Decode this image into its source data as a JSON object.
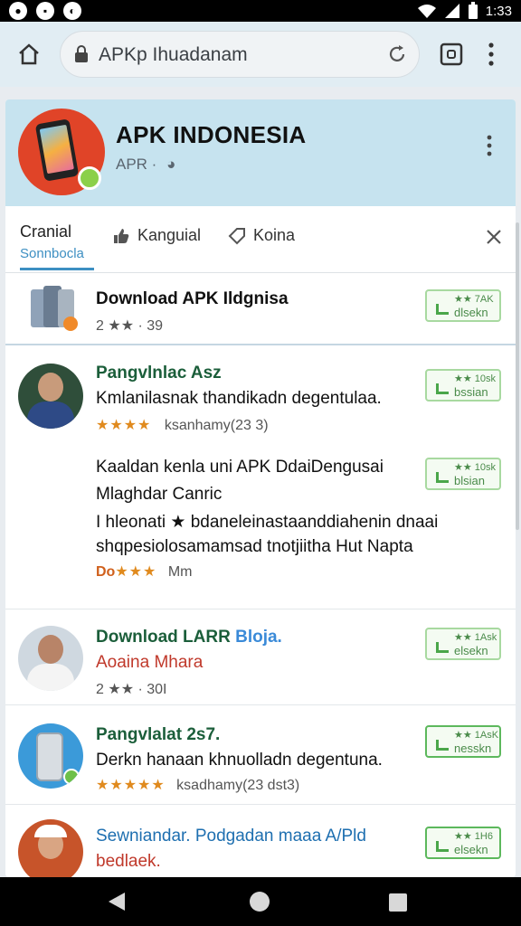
{
  "status_bar": {
    "time": "1:33"
  },
  "browser": {
    "url": "APKp Ihuadanam"
  },
  "header": {
    "title": "APK INDONESIA",
    "subtitle": "APR ·"
  },
  "tabs": [
    {
      "label": "Cranial",
      "sublabel": "Sonnbocla"
    },
    {
      "label": "Kanguial"
    },
    {
      "label": "Koina"
    }
  ],
  "rows": [
    {
      "title": "Download APK Ildgnisa",
      "meta": "2 ★★ · 39",
      "button": {
        "top": "★★ 7AK",
        "bottom": "dlsekn"
      }
    },
    {
      "title": "Pangvlnlac Asz",
      "line1": "Kmlanilasnak thandikadn degentulaa.",
      "stars": "★★★★",
      "meta": "ksanhamy(23 3)",
      "button": {
        "top": "★★ 10sk",
        "bottom": "bssian"
      }
    },
    {
      "line1": "Kaaldan kenla uni APK DdaiDengusai",
      "line2": "Mlaghdar Canric",
      "line3": "I hleonati ★ bdaneleinastaanddiahenin dnaai",
      "line4": "shqpesiolosamamsad tnotjiitha Hut Napta",
      "meta_prefix": "Do",
      "stars": "★★★",
      "meta": "Mm",
      "button": {
        "top": "★★ 10sk",
        "bottom": "blsian"
      }
    },
    {
      "title": "Download LARR",
      "title2": "Bloja.",
      "line1": "Aoaina Mhara",
      "meta": "2 ★★ · 30I",
      "button": {
        "top": "★★ 1Ask",
        "bottom": "elsekn"
      }
    },
    {
      "title": "Pangvlalat 2s7.",
      "line1": "Derkn hanaan khnuolladn degentuna.",
      "stars": "★★★★★",
      "meta": "ksadhamy(23 dst3)",
      "button": {
        "top": "★★ 1AsK",
        "bottom": "nesskn"
      }
    },
    {
      "title": "Sewniandar. Podgadan maaa A/Pld",
      "line1": "bedlaek.",
      "button": {
        "top": "★★ 1H6",
        "bottom": "elsekn"
      }
    }
  ]
}
